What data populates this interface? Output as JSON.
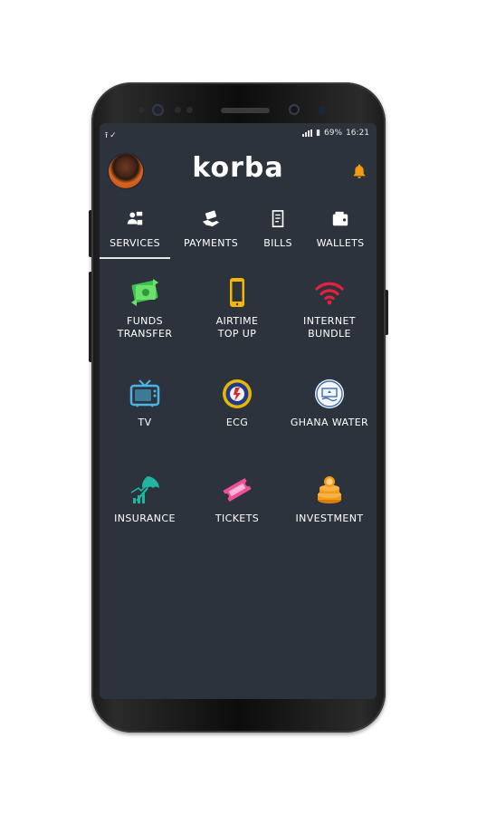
{
  "status_bar": {
    "left_icons": [
      "upload-icon",
      "check-icon"
    ],
    "battery": "69%",
    "time": "16:21"
  },
  "header": {
    "logo_text": "korba",
    "accent_color": "#f39c12"
  },
  "tabs": [
    {
      "label": "SERVICES",
      "icon": "services-icon",
      "active": true
    },
    {
      "label": "PAYMENTS",
      "icon": "payments-icon",
      "active": false
    },
    {
      "label": "BILLS",
      "icon": "bills-icon",
      "active": false
    },
    {
      "label": "WALLETS",
      "icon": "wallets-icon",
      "active": false
    }
  ],
  "services": [
    {
      "label_lines": [
        "FUNDS",
        "TRANSFER"
      ],
      "icon": "funds-transfer-icon",
      "color": "#5fd35f"
    },
    {
      "label_lines": [
        "AIRTIME",
        "TOP UP"
      ],
      "icon": "phone-icon",
      "color": "#f5b800"
    },
    {
      "label_lines": [
        "INTERNET",
        "BUNDLE"
      ],
      "icon": "wifi-icon",
      "color": "#e8203f"
    },
    {
      "label_lines": [
        "TV"
      ],
      "icon": "tv-icon",
      "color": "#4ab4e6"
    },
    {
      "label_lines": [
        "ECG"
      ],
      "icon": "ecg-logo-icon",
      "color": "#1f3a8a"
    },
    {
      "label_lines": [
        "GHANA WATER"
      ],
      "icon": "ghana-water-logo-icon",
      "color": "#3b6fb6"
    },
    {
      "label_lines": [
        "INSURANCE"
      ],
      "icon": "insurance-icon",
      "color": "#1fb5a0"
    },
    {
      "label_lines": [
        "TICKETS"
      ],
      "icon": "tickets-icon",
      "color": "#ee4f9a"
    },
    {
      "label_lines": [
        "INVESTMENT"
      ],
      "icon": "investment-icon",
      "color": "#f39c12"
    }
  ]
}
